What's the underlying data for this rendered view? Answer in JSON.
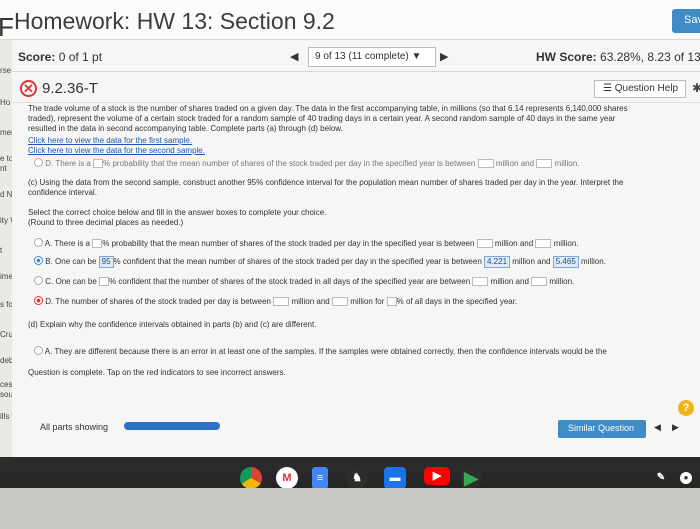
{
  "header": {
    "title": "Homework: HW 13: Section 9.2",
    "save_label": "Sav"
  },
  "left_strip": [
    "rse",
    "Ho",
    "mer",
    "e to",
    "nt",
    "d No",
    "ity W",
    "t",
    "imedi",
    "s for S",
    "Crunc",
    "debool",
    "cessible",
    "sources",
    "ills for S"
  ],
  "scorebar": {
    "score_label": "Score:",
    "score_value": "0 of 1 pt",
    "question_selector": "9 of 13 (11 complete)",
    "hw_score_label": "HW Score:",
    "hw_score_value": "63.28%, 8.23 of 13 p"
  },
  "question": {
    "id": "9.2.36-T",
    "help_label": "Question Help"
  },
  "content": {
    "intro_line1": "The trade volume of a stock is the number of shares traded on a given day. The data in the first accompanying table, in millions (so that 6.14 represents 6,140,000 shares",
    "intro_line2": "traded), represent the volume of a certain stock traded for a random sample of 40 trading days in a certain year. A second random sample of 40 days in the same year",
    "intro_line3": "resulted in the data in second accompanying table. Complete parts (a) through (d) below.",
    "link1": "Click here to view the data for the first sample.",
    "link2": "Click here to view the data for the second sample.",
    "prev_option": {
      "letter": "D.",
      "text_a": "There is a",
      "text_b": "% probability that the mean number of shares of the stock traded per day in the specified year is between",
      "text_c": "million and",
      "text_d": "million."
    },
    "part_c_line1": "(c) Using the data from the second sample, construct another 95% confidence interval for the population mean number of shares traded per day in the year. Interpret the",
    "part_c_line2": "confidence interval.",
    "instruction1": "Select the correct choice below and fill in the answer boxes to complete your choice.",
    "instruction2": "(Round to three decimal places as needed.)",
    "option_a": {
      "letter": "A.",
      "text_a": "There is a",
      "text_b": "% probability that the mean number of shares of the stock traded per day in the specified year is between",
      "text_c": "million and",
      "text_d": "million."
    },
    "option_b": {
      "letter": "B.",
      "text_a": "One can be",
      "value1": "95",
      "text_b": "% confident that the mean number of shares of the stock traded per day in the specified year is between",
      "value2": "4.221",
      "text_c": "million and",
      "value3": "5.465",
      "text_d": "million."
    },
    "option_c": {
      "letter": "C.",
      "text_a": "One can be",
      "text_b": "% confident that the number of shares of the stock traded in all days of the specified year are between",
      "text_c": "million and",
      "text_d": "million."
    },
    "option_d": {
      "letter": "D.",
      "text_a": "The number of shares of the stock traded per day is between",
      "text_b": "million and",
      "text_c": "million for",
      "text_d": "% of all days in the specified year."
    },
    "part_d": "(d) Explain why the confidence intervals obtained in parts (b) and (c) are different.",
    "part_d_option_a": {
      "letter": "A.",
      "text": "They are different because there is an error in at least one of the samples. If the samples were obtained correctly, then the confidence intervals would be the"
    },
    "complete_msg": "Question is complete. Tap on the red indicators to see incorrect answers."
  },
  "footer": {
    "all_parts_label": "All parts showing",
    "progress": 1.0,
    "similar_label": "Similar Question"
  },
  "dock": {
    "icons": [
      "chrome-icon",
      "gmail-icon",
      "docs-icon",
      "app-icon",
      "files-icon",
      "youtube-icon",
      "play-store-icon"
    ]
  },
  "colors": {
    "accent": "#3f8bc6",
    "error": "#d33333",
    "link": "#1a56b8"
  }
}
